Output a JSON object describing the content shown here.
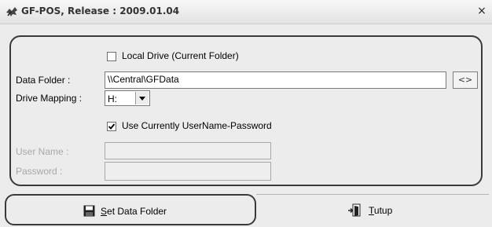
{
  "window": {
    "title": "GF-POS, Release : 2009.01.04",
    "app_icon": "app-logo-icon",
    "close_glyph": "×"
  },
  "form": {
    "local_drive": {
      "label": "Local Drive (Current Folder)",
      "checked": false
    },
    "data_folder": {
      "label": "Data Folder :",
      "value": "\\\\Central\\GFData",
      "browse_label": "<>"
    },
    "drive_mapping": {
      "label": "Drive Mapping :",
      "value": "H:"
    },
    "use_credentials": {
      "label": "Use Currently UserName-Password",
      "checked": true
    },
    "user_name": {
      "label": "User Name :",
      "value": ""
    },
    "password": {
      "label": "Password :",
      "value": ""
    }
  },
  "buttons": {
    "set_data_folder": {
      "label_first": "S",
      "label_rest": "et Data Folder",
      "icon": "floppy-disk-icon"
    },
    "tutup": {
      "label_first": "T",
      "label_rest": "utup",
      "icon": "exit-door-icon"
    }
  }
}
